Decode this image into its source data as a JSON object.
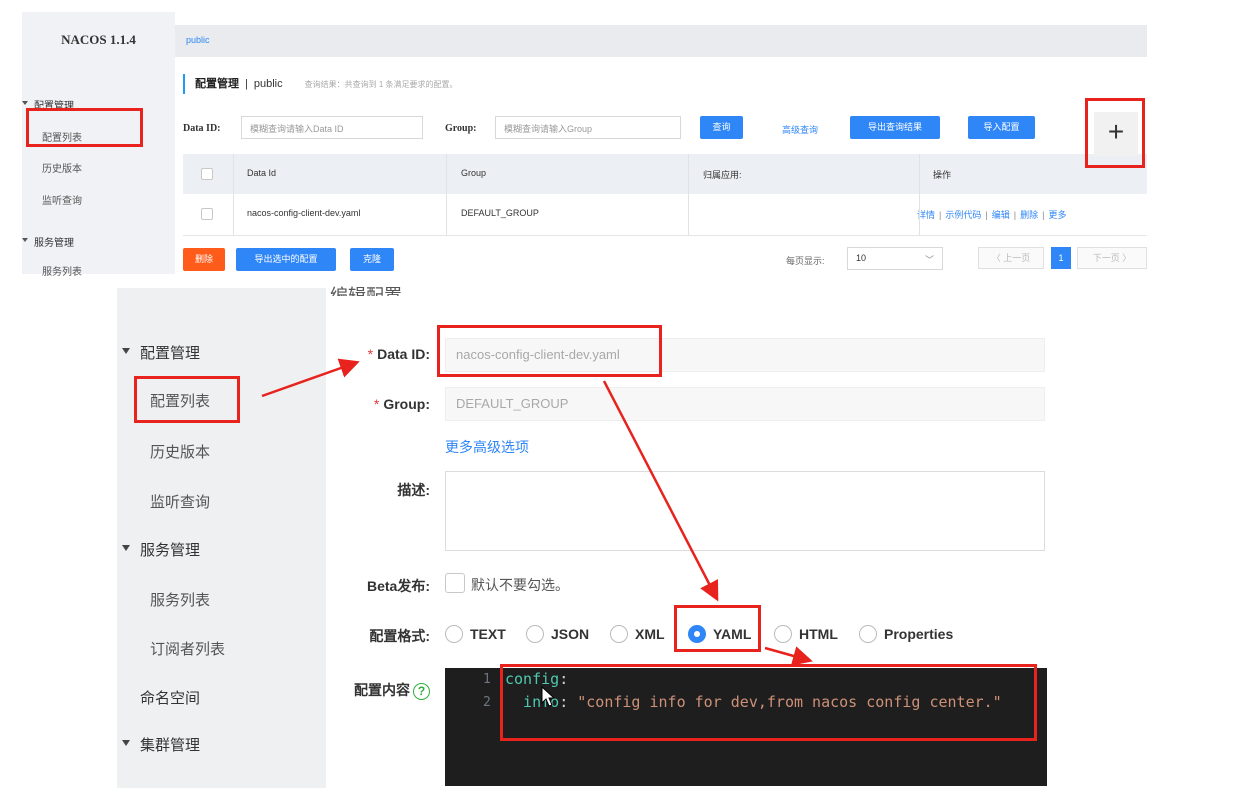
{
  "top": {
    "sidebar": {
      "brand": "NACOS 1.1.4",
      "group_config": "配置管理",
      "items": [
        "配置列表",
        "历史版本",
        "监听查询"
      ],
      "group_service": "服务管理",
      "service_items": [
        "服务列表"
      ]
    },
    "namespace_tab": "public",
    "title": "配置管理",
    "title_sep": "|",
    "title_ns": "public",
    "result_hint": "查询结果：共查询到 1 条满足要求的配置。",
    "search": {
      "dataid_label": "Data ID:",
      "dataid_placeholder": "模糊查询请输入Data ID",
      "group_label": "Group:",
      "group_placeholder": "模糊查询请输入Group",
      "query_btn": "查询",
      "advanced_link": "高级查询",
      "export_btn": "导出查询结果",
      "import_btn": "导入配置",
      "add_btn": "+"
    },
    "table": {
      "headers": [
        "Data Id",
        "Group",
        "归属应用:",
        "操作"
      ],
      "rows": [
        {
          "data_id": "nacos-config-client-dev.yaml",
          "group": "DEFAULT_GROUP",
          "app": "",
          "ops": [
            "详情",
            "示例代码",
            "编辑",
            "删除",
            "更多"
          ]
        }
      ]
    },
    "footer": {
      "delete_btn": "删除",
      "export_selected_btn": "导出选中的配置",
      "clone_btn": "克隆",
      "page_size_label": "每页显示:",
      "page_size": "10",
      "prev": "〈 上一页",
      "page": "1",
      "next": "下一页 〉"
    }
  },
  "bottom": {
    "title": "编辑配置",
    "sidebar": {
      "group_config": "配置管理",
      "items": [
        "配置列表",
        "历史版本",
        "监听查询"
      ],
      "group_service": "服务管理",
      "service_items": [
        "服务列表",
        "订阅者列表"
      ],
      "namespace": "命名空间",
      "group_cluster": "集群管理"
    },
    "form": {
      "required_mark": "*",
      "dataid_label": "Data ID:",
      "dataid_value": "nacos-config-client-dev.yaml",
      "group_label": "Group:",
      "group_value": "DEFAULT_GROUP",
      "more_options": "更多高级选项",
      "desc_label": "描述:",
      "beta_label": "Beta发布:",
      "beta_text": "默认不要勾选。",
      "format_label": "配置格式:",
      "formats": [
        "TEXT",
        "JSON",
        "XML",
        "YAML",
        "HTML",
        "Properties"
      ],
      "selected_format": "YAML",
      "content_label": "配置内容",
      "help_glyph": "?"
    },
    "editor": {
      "line_numbers": [
        "1",
        "2"
      ],
      "line1_key": "config",
      "line1_colon": ":",
      "line2_key": "  info",
      "line2_colon": ": ",
      "line2_value": "\"config info for dev,from nacos config center.\""
    }
  },
  "colors": {
    "accent": "#2f86f6",
    "danger": "#ff5b1a",
    "annotation": "#e8231d",
    "editor_bg": "#1e1e1e"
  }
}
